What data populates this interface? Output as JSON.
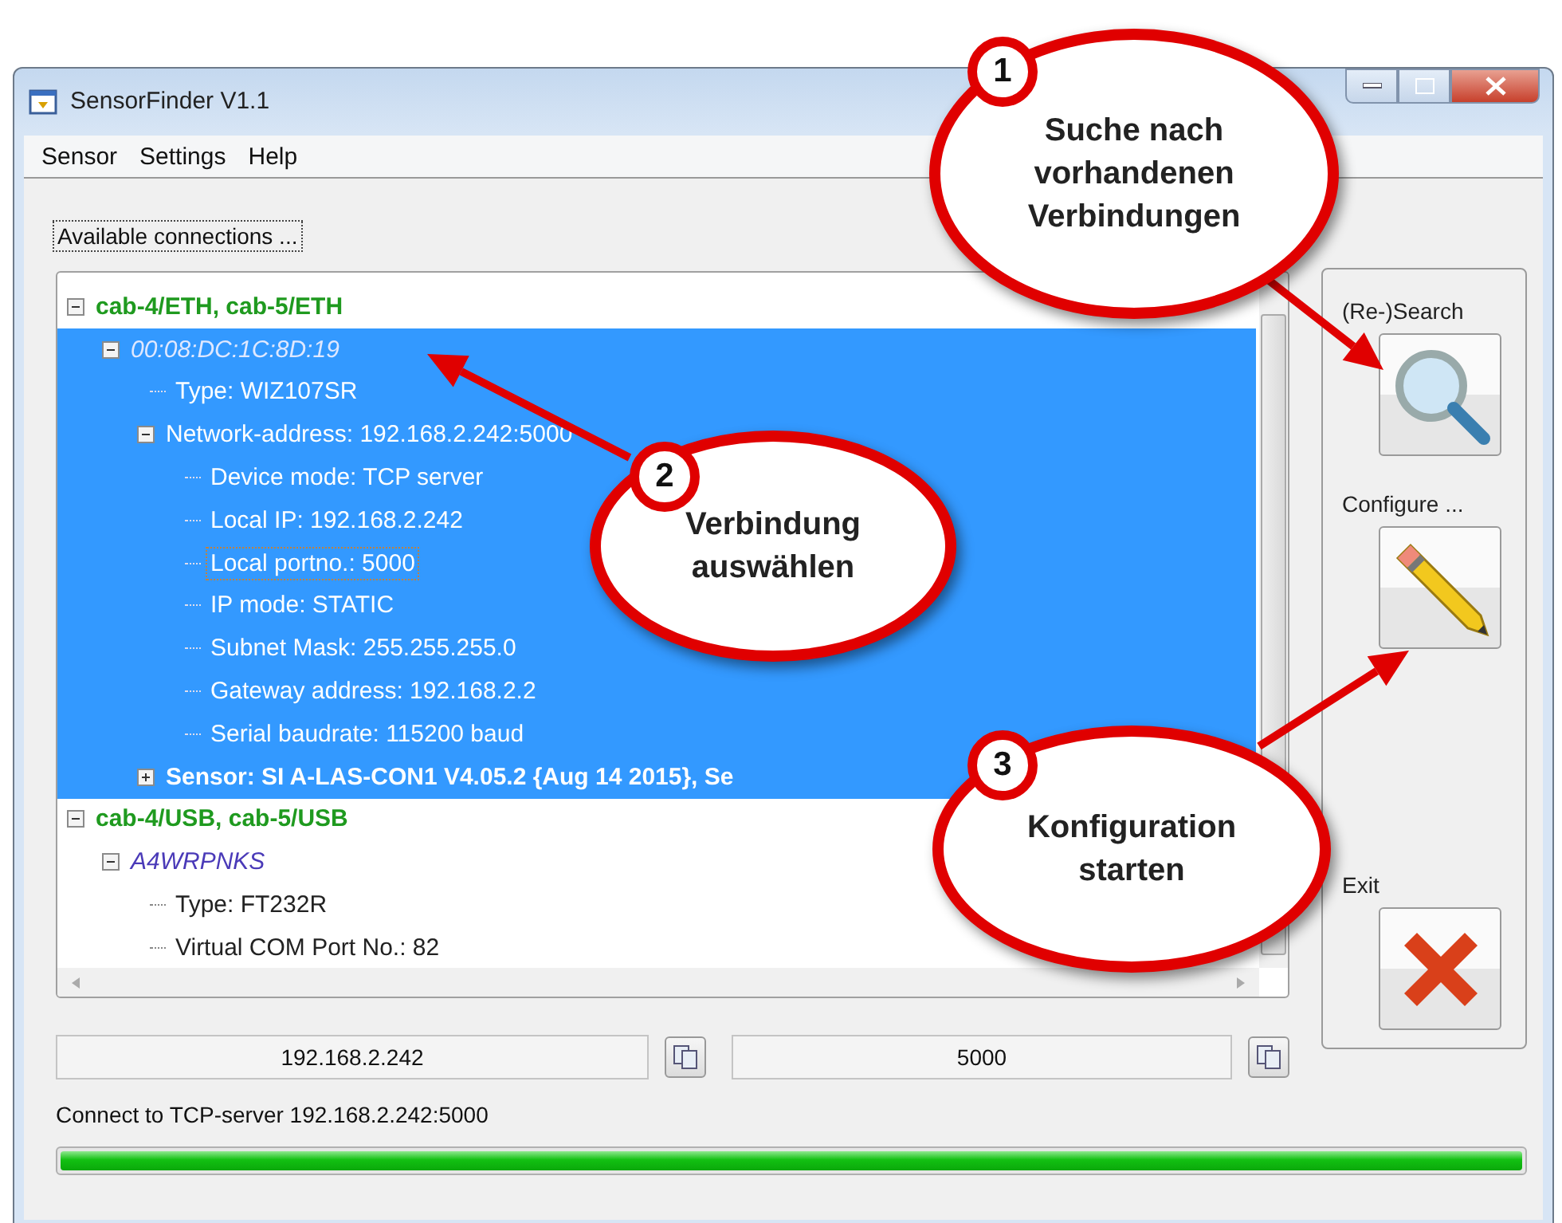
{
  "window": {
    "title": "SensorFinder V1.1"
  },
  "menu": [
    "Sensor",
    "Settings",
    "Help"
  ],
  "group_label": "Available connections ...",
  "tree": [
    {
      "label": "cab-4/ETH, cab-5/ETH",
      "kind": "group",
      "expanded": true,
      "selected": false,
      "focused": false,
      "children": [
        {
          "label": "00:08:DC:1C:8D:19",
          "kind": "device",
          "expanded": true,
          "selected": true,
          "focused": false,
          "children": [
            {
              "label": "Type: WIZ107SR",
              "kind": "property",
              "selected": true,
              "focused": false
            },
            {
              "label": "Network-address: 192.168.2.242:5000",
              "kind": "property",
              "expanded": true,
              "selected": true,
              "focused": false,
              "children": [
                {
                  "label": "Device mode: TCP server",
                  "kind": "property",
                  "selected": true,
                  "focused": false
                },
                {
                  "label": "Local IP: 192.168.2.242",
                  "kind": "property",
                  "selected": true,
                  "focused": false
                },
                {
                  "label": "Local portno.: 5000",
                  "kind": "property",
                  "selected": true,
                  "focused": true
                },
                {
                  "label": "IP mode: STATIC",
                  "kind": "property",
                  "selected": true,
                  "focused": false
                },
                {
                  "label": "Subnet Mask: 255.255.255.0",
                  "kind": "property",
                  "selected": true,
                  "focused": false
                },
                {
                  "label": "Gateway address: 192.168.2.2",
                  "kind": "property",
                  "selected": true,
                  "focused": false
                },
                {
                  "label": "Serial baudrate: 115200 baud",
                  "kind": "property",
                  "selected": true,
                  "focused": false
                }
              ]
            },
            {
              "label": "Sensor: SI A-LAS-CON1 V4.05.2 {Aug 14 2015}, Se",
              "kind": "sensor",
              "expanded": false,
              "selected": true,
              "focused": false
            }
          ]
        }
      ]
    },
    {
      "label": "cab-4/USB, cab-5/USB",
      "kind": "group",
      "expanded": true,
      "selected": false,
      "focused": false,
      "children": [
        {
          "label": "A4WRPNKS",
          "kind": "device",
          "expanded": true,
          "selected": false,
          "focused": false,
          "children": [
            {
              "label": "Type: FT232R",
              "kind": "property",
              "selected": false,
              "focused": false
            },
            {
              "label": "Virtual COM Port No.: 82",
              "kind": "property",
              "selected": false,
              "focused": false
            }
          ]
        }
      ]
    }
  ],
  "side_buttons": [
    {
      "label": "(Re-)Search",
      "kind": "search"
    },
    {
      "label": "Configure ...",
      "kind": "configure"
    },
    {
      "label": "Exit",
      "kind": "exit"
    }
  ],
  "fields": [
    {
      "value": "192.168.2.242"
    },
    {
      "value": "5000"
    }
  ],
  "status": "Connect to TCP-server 192.168.2.242:5000",
  "progress": {
    "level": 1
  },
  "callouts": [
    {
      "number": "1",
      "text": "Suche nach vorhandenen Verbindungen"
    },
    {
      "number": "2",
      "text": "Verbindung auswählen"
    },
    {
      "number": "3",
      "text": "Konfiguration starten"
    }
  ]
}
